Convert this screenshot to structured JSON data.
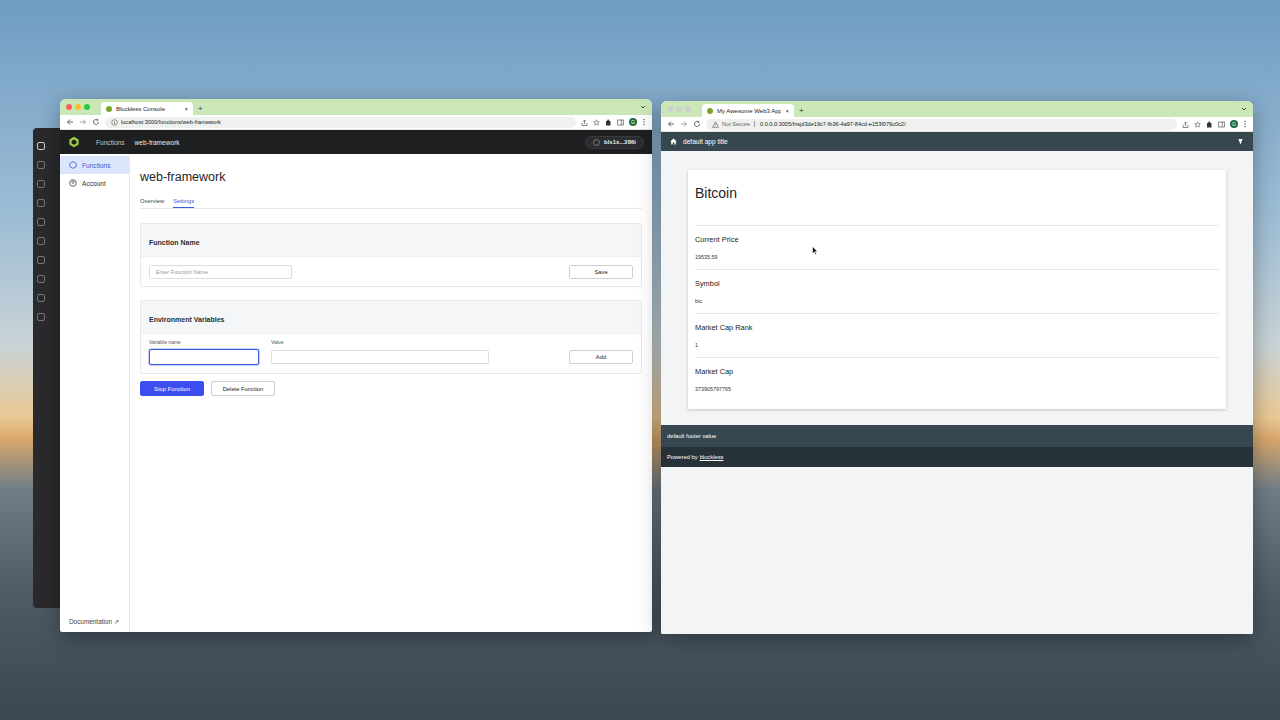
{
  "console_window": {
    "tab": {
      "title": "Blockless Console",
      "close": "×"
    },
    "new_tab": "+",
    "url": "localhost:3000/functions/web-framework",
    "profile": "G",
    "breadcrumb": [
      "Functions",
      "web-framework"
    ],
    "account": "bls1x...286i",
    "sidebar": {
      "items": [
        {
          "label": "Functions",
          "selected": true
        },
        {
          "label": "Account",
          "selected": false
        }
      ],
      "documentation": "Documentation ↗"
    },
    "title": "web-framework",
    "tabs": [
      {
        "label": "Overview",
        "selected": false
      },
      {
        "label": "Settings",
        "selected": true
      }
    ],
    "function_name": {
      "heading": "Function Name",
      "placeholder": "Enter Function Name",
      "button": "Save"
    },
    "env": {
      "heading": "Environment Variables",
      "name_label": "Variable name",
      "value_label": "Value",
      "button": "Add",
      "name_focused": true
    },
    "actions": [
      {
        "label": "Stop Function",
        "kind": "primary"
      },
      {
        "label": "Delete Function",
        "kind": "secondary"
      }
    ]
  },
  "app_window": {
    "tab": {
      "title": "My Awesome Web3 App",
      "close": "×"
    },
    "new_tab": "+",
    "not_secure": "Not Secure",
    "url": "0.0.0.0:3005/fnsjd3de19c7-fb36-4a97-84cd-e153f079c0c2/",
    "profile": "G",
    "header_title": "default app title",
    "card_title": "Bitcoin",
    "fields": [
      {
        "label": "Current Price",
        "value": "19535.59"
      },
      {
        "label": "Symbol",
        "value": "btc"
      },
      {
        "label": "Market Cap Rank",
        "value": "1"
      },
      {
        "label": "Market Cap",
        "value": "373905797765"
      }
    ],
    "footer": "default footer value",
    "powered_by": "Powered by",
    "powered_link": "blockless"
  }
}
